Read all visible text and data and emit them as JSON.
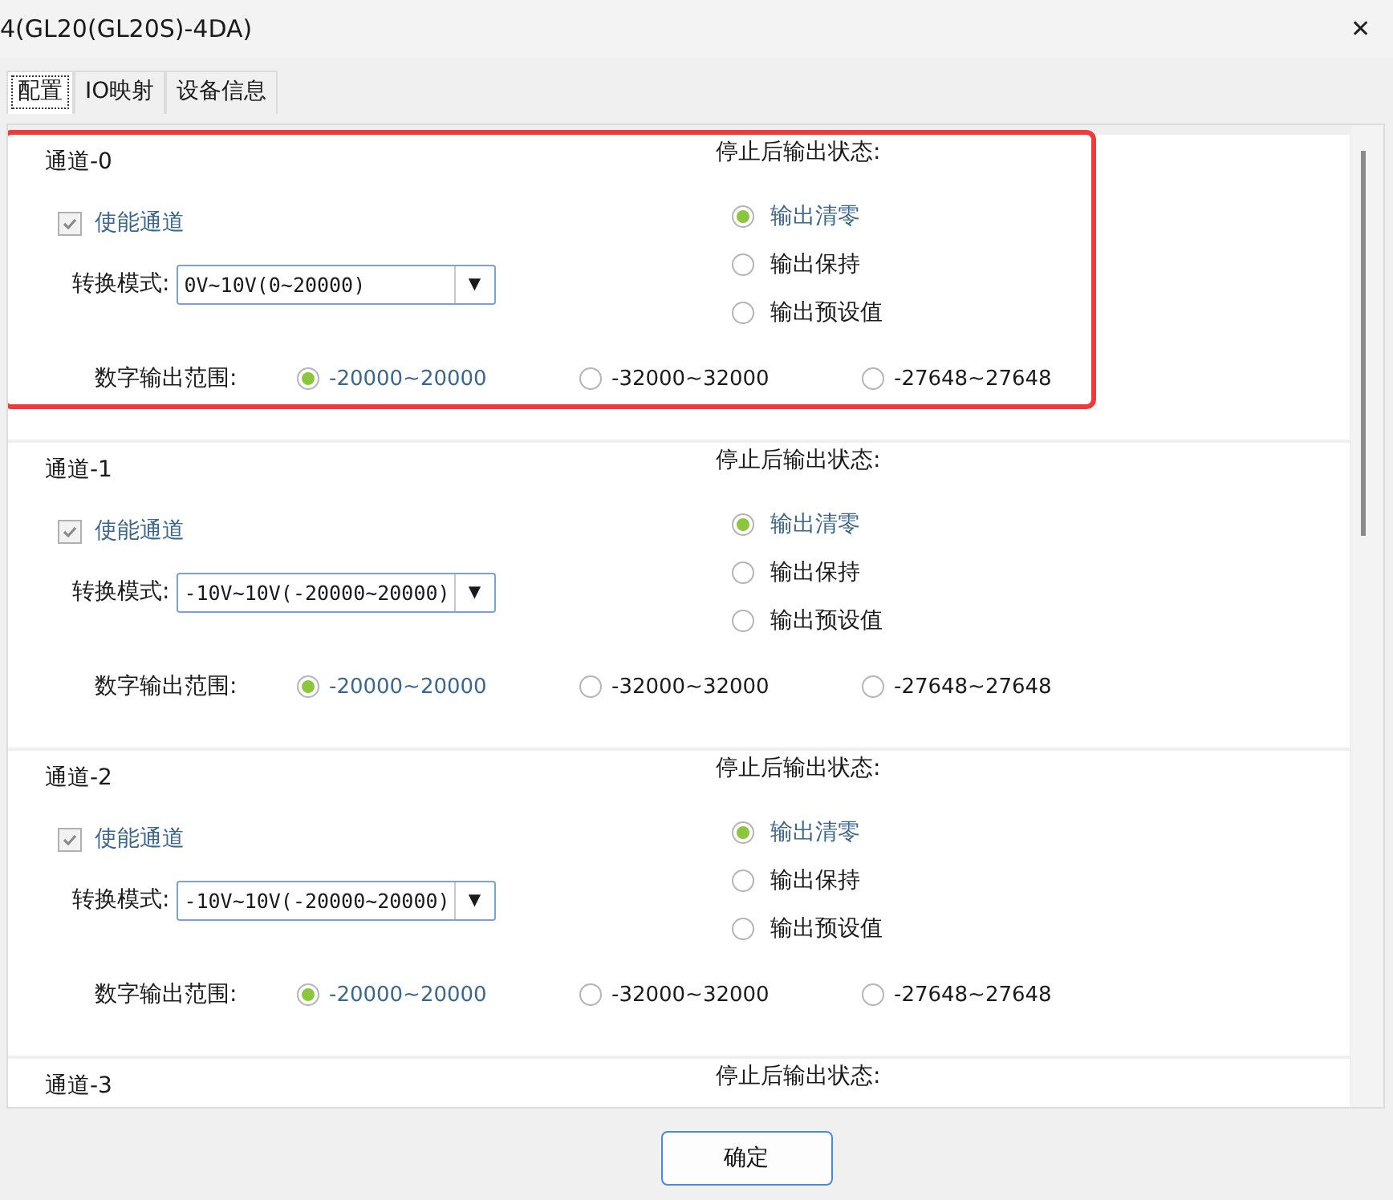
{
  "window": {
    "title": "4(GL20(GL20S)-4DA)",
    "close": "✕"
  },
  "tabs": [
    {
      "label": "配置",
      "selected": true
    },
    {
      "label": "IO映射",
      "selected": false
    },
    {
      "label": "设备信息",
      "selected": false
    }
  ],
  "channels": [
    {
      "title": "通道-0",
      "highlighted": true,
      "enable": {
        "label": "使能通道",
        "checked": true
      },
      "mode": {
        "label": "转换模式:",
        "value": "0V~10V(0~20000)",
        "arrow": "▼"
      },
      "range": {
        "label": "数字输出范围:",
        "options": [
          {
            "label": "-20000~20000",
            "selected": true
          },
          {
            "label": "-32000~32000",
            "selected": false
          },
          {
            "label": "-27648~27648",
            "selected": false
          }
        ]
      },
      "stop": {
        "label": "停止后输出状态:",
        "options": [
          {
            "label": "输出清零",
            "selected": true
          },
          {
            "label": "输出保持",
            "selected": false
          },
          {
            "label": "输出预设值",
            "selected": false
          }
        ]
      }
    },
    {
      "title": "通道-1",
      "highlighted": false,
      "enable": {
        "label": "使能通道",
        "checked": true
      },
      "mode": {
        "label": "转换模式:",
        "value": "-10V~10V(-20000~20000)",
        "arrow": "▼"
      },
      "range": {
        "label": "数字输出范围:",
        "options": [
          {
            "label": "-20000~20000",
            "selected": true
          },
          {
            "label": "-32000~32000",
            "selected": false
          },
          {
            "label": "-27648~27648",
            "selected": false
          }
        ]
      },
      "stop": {
        "label": "停止后输出状态:",
        "options": [
          {
            "label": "输出清零",
            "selected": true
          },
          {
            "label": "输出保持",
            "selected": false
          },
          {
            "label": "输出预设值",
            "selected": false
          }
        ]
      }
    },
    {
      "title": "通道-2",
      "highlighted": false,
      "enable": {
        "label": "使能通道",
        "checked": true
      },
      "mode": {
        "label": "转换模式:",
        "value": "-10V~10V(-20000~20000)",
        "arrow": "▼"
      },
      "range": {
        "label": "数字输出范围:",
        "options": [
          {
            "label": "-20000~20000",
            "selected": true
          },
          {
            "label": "-32000~32000",
            "selected": false
          },
          {
            "label": "-27648~27648",
            "selected": false
          }
        ]
      },
      "stop": {
        "label": "停止后输出状态:",
        "options": [
          {
            "label": "输出清零",
            "selected": true
          },
          {
            "label": "输出保持",
            "selected": false
          },
          {
            "label": "输出预设值",
            "selected": false
          }
        ]
      }
    },
    {
      "title": "通道-3",
      "stop": {
        "label": "停止后输出状态:"
      }
    }
  ],
  "ok_button": "确定"
}
